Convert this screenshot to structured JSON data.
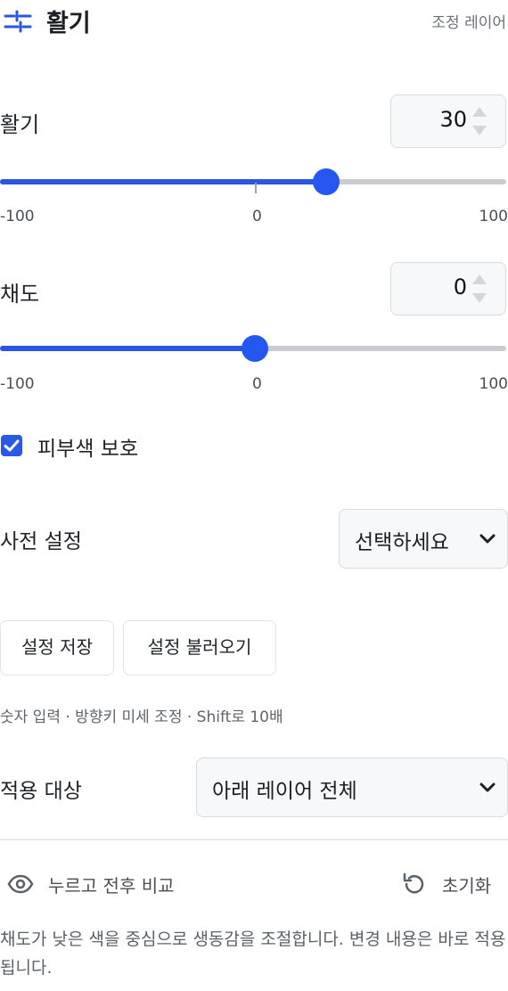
{
  "header": {
    "title": "활기",
    "subtitle": "조정 레이어",
    "icon": "sliders-icon"
  },
  "vibrance": {
    "label": "활기",
    "value": "30",
    "min_label": "-100",
    "mid_label": "0",
    "max_label": "100",
    "level": 30
  },
  "saturation": {
    "label": "채도",
    "value": "0",
    "min_label": "-100",
    "mid_label": "0",
    "max_label": "100",
    "level": 0
  },
  "skin_protect": {
    "label": "피부색 보호",
    "checked": true
  },
  "preset": {
    "label": "사전 설정",
    "selected": "선택하세요"
  },
  "buttons": {
    "save": "설정 저장",
    "load": "설정 불러오기"
  },
  "hint": "숫자 입력 · 방향키 미세 조정 · Shift로 10배",
  "apply_to": {
    "label": "적용 대상",
    "selected": "아래 레이어 전체"
  },
  "footer": {
    "compare": "누르고 전후 비교",
    "reset": "초기화"
  },
  "description": "채도가 낮은 색을 중심으로 생동감을 조절합니다. 변경 내용은 바로 적용됩니다.",
  "colors": {
    "accent": "#2457f0",
    "track": "#c9ccd1"
  }
}
